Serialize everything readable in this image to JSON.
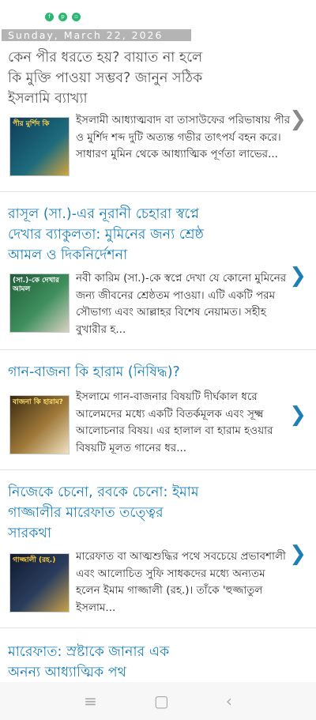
{
  "header": {
    "social_icons": [
      "facebook-icon",
      "pinterest-icon",
      "instagram-icon"
    ],
    "date": "Sunday, March 22, 2026"
  },
  "posts": [
    {
      "title": "কেন পীর ধরতে হয়? বায়াত না হলে কি মুক্তি পাওয়া সম্ভব? জানুন সঠিক ইসলামি ব্যাখ্যা",
      "excerpt": "ইসলামী আধ্যাত্মবাদ বা তাসাউফের পরিভাষায় পীর ও মুর্শিদ শব্দ দুটি অত্যন্ত গভীর তাৎপর্য বহন করে। সাধারণ মুমিন থেকে আধ্যাত্মিক পূর্ণতা লাভের...",
      "thumb_text": "পীর মুর্শিদ কি"
    },
    {
      "title": "রাসূল (সা.)-এর নূরানী চেহারা স্বপ্নে দেখার ব্যাকুলতা: মুমিনের জন্য শ্রেষ্ঠ আমল ও দিকনির্দেশনা",
      "excerpt": "নবী কারিম (সা.)-কে স্বপ্নে দেখা যে কোনো মুমিনের জন্য জীবনের শ্রেষ্ঠতম পাওয়া। এটি একটি পরম সৌভাগ্য এবং আল্লাহর বিশেষ নেয়ামত। সহীহ বুখারীর হ...",
      "thumb_text": "(সা.)-কে দেখার আমল"
    },
    {
      "title": "গান-বাজনা কি হারাম (নিষিদ্ধ)?",
      "excerpt": "ইসলামে গান-বাজনার বিষয়টি দীর্ঘকাল ধরে আলেমদের মধ্যে একটি বিতর্কমূলক এবং সূক্ষ্ম আলোচনার বিষয়। এর হালাল বা হারাম হওয়ার বিষয়টি মূলত গানের ধর...",
      "thumb_text": "বাজনা কি হারাম?"
    },
    {
      "title": "নিজেকে চেনো, রবকে চেনো: ইমাম গাজ্জালীর মারেফাত তত্ত্বের সারকথা",
      "excerpt": "মারেফাত বা আত্মশুদ্ধির পথে সবচেয়ে প্রভাবশালী এবং আলোচিত সুফি সাধকদের মধ্যে অন্যতম হলেন ইমাম গাজ্জালী (রহ.)। তাঁকে 'হুজ্জাতুল ইসলাম...",
      "thumb_text": "গাজ্জালী (রহ.)"
    },
    {
      "title": "মারেফাত: স্রষ্টাকে জানার এক অনন্য আধ্যাত্মিক পথ"
    }
  ],
  "chevron": "❯",
  "navbar": {
    "menu": "≡",
    "home": "▢",
    "back": "‹"
  }
}
